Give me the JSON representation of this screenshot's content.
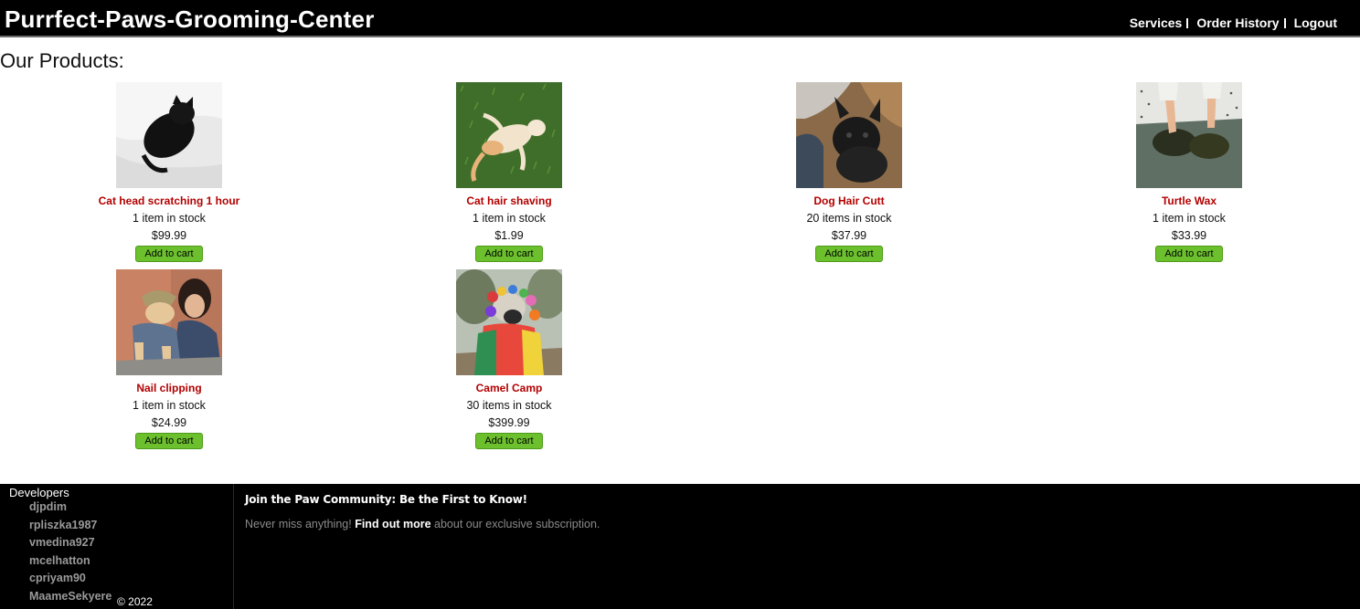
{
  "header": {
    "title": "Purrfect-Paws-Grooming-Center",
    "nav": [
      "Services",
      "Order History",
      "Logout"
    ]
  },
  "main": {
    "heading": "Our Products:",
    "products": [
      {
        "name": "Cat head scratching 1 hour",
        "stock": "1 item in stock",
        "price": "$99.99",
        "button": "Add to cart",
        "image": "black-cat-photo"
      },
      {
        "name": "Cat hair shaving",
        "stock": "1 item in stock",
        "price": "$1.99",
        "button": "Add to cart",
        "image": "cat-on-grass-photo"
      },
      {
        "name": "Dog Hair Cutt",
        "stock": "20 items in stock",
        "price": "$37.99",
        "button": "Add to cart",
        "image": "french-bulldog-photo"
      },
      {
        "name": "Turtle Wax",
        "stock": "1 item in stock",
        "price": "$33.99",
        "button": "Add to cart",
        "image": "turtles-photo"
      },
      {
        "name": "Nail clipping",
        "stock": "1 item in stock",
        "price": "$24.99",
        "button": "Add to cart",
        "image": "dog-with-woman-photo"
      },
      {
        "name": "Camel Camp",
        "stock": "30 items in stock",
        "price": "$399.99",
        "button": "Add to cart",
        "image": "llama-with-pompoms-photo"
      }
    ]
  },
  "footer": {
    "developers_title": "Developers",
    "developers": [
      "djpdim",
      "rpliszka1987",
      "vmedina927",
      "mcelhatton",
      "cpriyam90",
      "MaameSekyere"
    ],
    "copyright": "© 2022",
    "newsletter_title": "Join the Paw Community: Be the First to Know!",
    "newsletter_prefix": "Never miss anything!",
    "newsletter_cta": "Find out more",
    "newsletter_suffix": "about our exclusive subscription."
  },
  "colors": {
    "header_bg": "#000000",
    "product_name": "#b30000",
    "button_bg": "#6cc02e"
  }
}
